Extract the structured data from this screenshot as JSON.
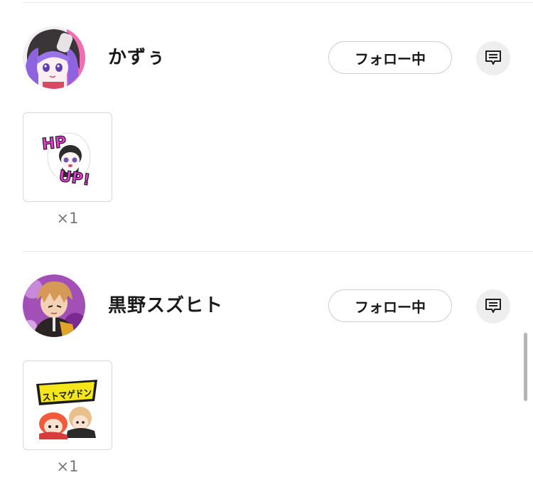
{
  "users": [
    {
      "name": "かずぅ",
      "follow_label": "フォロー中",
      "sticker_count": "×1",
      "sticker_text": [
        "HP",
        "UP!"
      ]
    },
    {
      "name": "黒野スズヒト",
      "follow_label": "フォロー中",
      "sticker_count": "×1",
      "sticker_text": [
        "ストマゲドン"
      ]
    }
  ],
  "icons": {
    "message": "chat-bubble-icon"
  },
  "colors": {
    "pink_accent": "#e93bd6",
    "yellow_accent": "#f5e61c",
    "divider": "#e9e9e9"
  }
}
